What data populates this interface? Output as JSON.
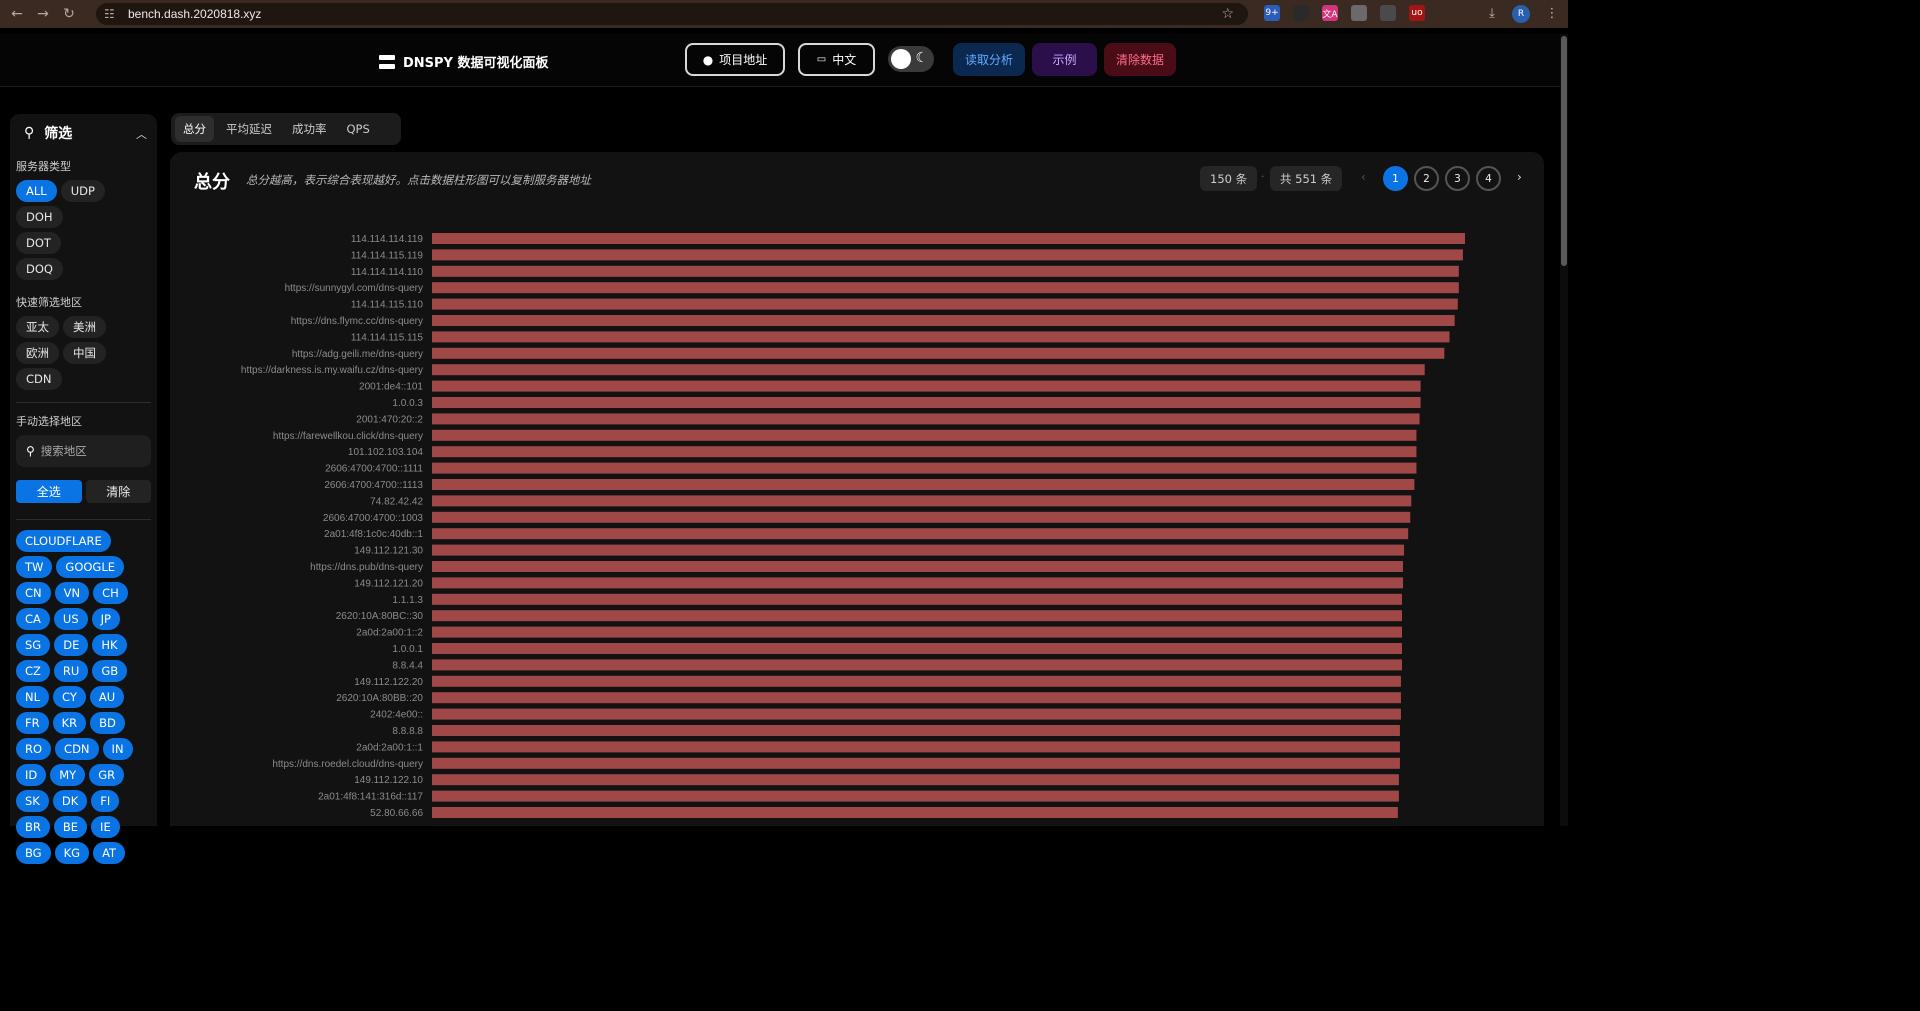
{
  "browser": {
    "url": "bench.dash.2020818.xyz",
    "extensions": [
      {
        "name": "translate-ext-icon",
        "label": "9+",
        "color": "#2c5bb8"
      },
      {
        "name": "ghost-ext-icon",
        "label": "",
        "color": "#2a2a2a"
      },
      {
        "name": "translate-alt-ext-icon",
        "label": "文A",
        "color": "#d2367a"
      },
      {
        "name": "gear-ext-icon",
        "label": "",
        "color": "#6a6a6a"
      },
      {
        "name": "spy-ext-icon",
        "label": "",
        "color": "#4a4a4a"
      },
      {
        "name": "ublock-ext-icon",
        "label": "uo",
        "color": "#a31515"
      },
      {
        "name": "puzzle-ext-icon",
        "label": "",
        "color": "#3a2a22"
      }
    ],
    "profile_initial": "R"
  },
  "header": {
    "title": "DNSPY 数据可视化面板",
    "repo_label": "项目地址",
    "lang_label": "中文",
    "read_label": "读取分析",
    "example_label": "示例",
    "clear_label": "清除数据",
    "colors": {
      "read_bg": "#0b2850",
      "read_fg": "#66aaff",
      "example_bg": "#2a0f4a",
      "example_fg": "#c9a8ff",
      "clear_bg": "#4a0d18",
      "clear_fg": "#ff6b8a"
    }
  },
  "sidebar": {
    "title": "筛选",
    "server_type_label": "服务器类型",
    "server_types": [
      {
        "label": "ALL",
        "active": true
      },
      {
        "label": "UDP",
        "active": false
      },
      {
        "label": "DOH",
        "active": false
      },
      {
        "label": "DOT",
        "active": false
      },
      {
        "label": "DOQ",
        "active": false
      }
    ],
    "quick_region_label": "快速筛选地区",
    "quick_regions": [
      "亚太",
      "美洲",
      "欧洲",
      "中国",
      "CDN"
    ],
    "manual_region_label": "手动选择地区",
    "search_placeholder": "搜索地区",
    "select_all_label": "全选",
    "clear_label": "清除",
    "regions": [
      [
        "CLOUDFLARE"
      ],
      [
        "TW",
        "GOOGLE"
      ],
      [
        "CN",
        "VN",
        "CH"
      ],
      [
        "CA",
        "US",
        "JP"
      ],
      [
        "SG",
        "DE",
        "HK"
      ],
      [
        "CZ",
        "RU",
        "GB"
      ],
      [
        "NL",
        "CY",
        "AU"
      ],
      [
        "FR",
        "KR",
        "BD"
      ],
      [
        "RO",
        "CDN",
        "IN"
      ],
      [
        "ID",
        "MY",
        "GR"
      ],
      [
        "SK",
        "DK",
        "FI"
      ],
      [
        "BR",
        "BE",
        "IE"
      ],
      [
        "BG",
        "KG",
        "AT"
      ]
    ]
  },
  "tabs": [
    {
      "label": "总分",
      "active": true
    },
    {
      "label": "平均延迟",
      "active": false
    },
    {
      "label": "成功率",
      "active": false
    },
    {
      "label": "QPS",
      "active": false
    }
  ],
  "panel": {
    "title": "总分",
    "description": "总分越高，表示综合表现越好。点击数据柱形图可以复制服务器地址",
    "per_page_label": "150 条",
    "total_label": "共 551 条",
    "pages": [
      "1",
      "2",
      "3",
      "4"
    ],
    "current_page": "1",
    "separator": "·"
  },
  "chart_data": {
    "type": "bar",
    "orientation": "horizontal",
    "bar_color": "#a04848",
    "categories": [
      "114.114.114.119",
      "114.114.115.119",
      "114.114.114.110",
      "https://sunnygyl.com/dns-query",
      "114.114.115.110",
      "https://dns.flymc.cc/dns-query",
      "114.114.115.115",
      "https://adg.geili.me/dns-query",
      "https://darkness.is.my.waifu.cz/dns-query",
      "2001:de4::101",
      "1.0.0.3",
      "2001:470:20::2",
      "https://farewellkou.click/dns-query",
      "101.102.103.104",
      "2606:4700:4700::1111",
      "2606:4700:4700::1113",
      "74.82.42.42",
      "2606:4700:4700::1003",
      "2a01:4f8:1c0c:40db::1",
      "149.112.121.30",
      "https://dns.pub/dns-query",
      "149.112.121.20",
      "1.1.1.3",
      "2620:10A:80BC::30",
      "2a0d:2a00:1::2",
      "1.0.0.1",
      "8.8.4.4",
      "149.112.122.20",
      "2620:10A:80BB::20",
      "2402:4e00::",
      "8.8.8.8",
      "2a0d:2a00:1::1",
      "https://dns.roedel.cloud/dns-query",
      "149.112.122.10",
      "2a01:4f8:141:316d::117",
      "52.80.66.66"
    ],
    "values": [
      100.0,
      99.8,
      99.4,
      99.4,
      99.3,
      99.0,
      98.5,
      98.0,
      96.1,
      95.7,
      95.7,
      95.6,
      95.3,
      95.3,
      95.3,
      95.1,
      94.8,
      94.7,
      94.5,
      94.1,
      94.0,
      94.0,
      93.9,
      93.9,
      93.9,
      93.9,
      93.9,
      93.8,
      93.8,
      93.8,
      93.7,
      93.7,
      93.7,
      93.6,
      93.6,
      93.5
    ],
    "xlim": [
      0,
      100
    ]
  }
}
